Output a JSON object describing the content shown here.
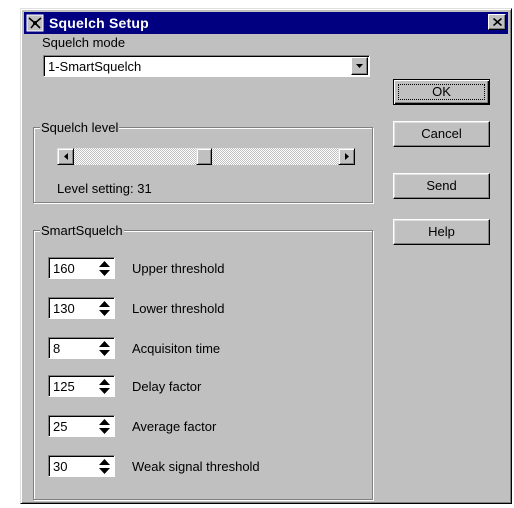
{
  "window": {
    "title": "Squelch Setup"
  },
  "squelch_mode": {
    "label": "Squelch mode",
    "value": "1-SmartSquelch"
  },
  "squelch_level": {
    "group_label": "Squelch level",
    "level_label": "Level setting:",
    "level_value": "31",
    "slider_fraction": 0.49
  },
  "buttons": {
    "ok": "OK",
    "cancel": "Cancel",
    "send": "Send",
    "help": "Help"
  },
  "smartsquelch": {
    "group_label": "SmartSquelch",
    "fields": [
      {
        "value": "160",
        "label": "Upper threshold"
      },
      {
        "value": "130",
        "label": "Lower threshold"
      },
      {
        "value": "8",
        "label": "Acquisiton time"
      },
      {
        "value": "125",
        "label": "Delay factor"
      },
      {
        "value": "25",
        "label": "Average factor"
      },
      {
        "value": "30",
        "label": "Weak signal threshold"
      }
    ]
  },
  "colors": {
    "titlebar": "#000080",
    "face": "#c0c0c0",
    "field": "#ffffff"
  },
  "icons": {
    "title": "squelch-app-icon",
    "close": "close-icon",
    "dropdown": "chevron-down-icon",
    "scroll_left": "arrow-left-icon",
    "scroll_right": "arrow-right-icon",
    "spin": "spin-up-down-icon"
  }
}
